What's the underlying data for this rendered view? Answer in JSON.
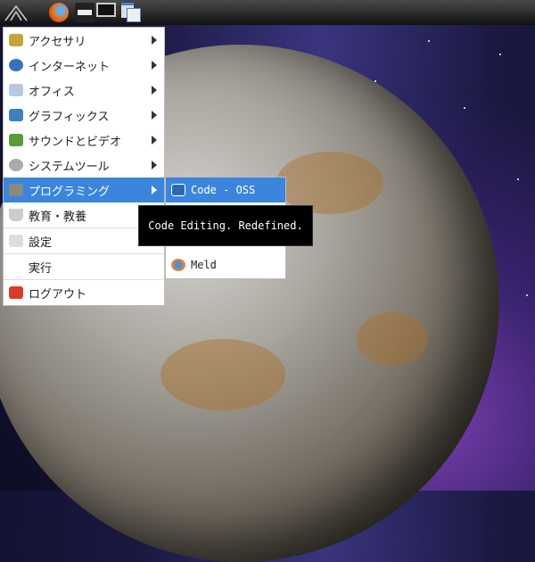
{
  "panel": {
    "icons": [
      "launcher-icon",
      "firefox-icon",
      "file-manager-icon",
      "display-icon",
      "window-switcher-icon"
    ]
  },
  "menu": {
    "items": [
      {
        "label": "アクセサリ",
        "icon": "accessories-icon",
        "submenu": true
      },
      {
        "label": "インターネット",
        "icon": "internet-icon",
        "submenu": true
      },
      {
        "label": "オフィス",
        "icon": "office-icon",
        "submenu": true
      },
      {
        "label": "グラフィックス",
        "icon": "graphics-icon",
        "submenu": true
      },
      {
        "label": "サウンドとビデオ",
        "icon": "sound-video-icon",
        "submenu": true
      },
      {
        "label": "システムツール",
        "icon": "system-tools-icon",
        "submenu": true
      },
      {
        "label": "プログラミング",
        "icon": "programming-icon",
        "submenu": true
      },
      {
        "label": "教育・教養",
        "icon": "education-icon",
        "submenu": true
      },
      {
        "label": "設定",
        "icon": "settings-icon",
        "submenu": false
      },
      {
        "label": "実行",
        "icon": "",
        "submenu": false
      },
      {
        "label": "ログアウト",
        "icon": "logout-icon",
        "submenu": false
      }
    ]
  },
  "submenu": {
    "items": [
      {
        "label": "Code - OSS",
        "icon": "code-oss-icon"
      },
      {
        "label": "Meld",
        "icon": "meld-icon"
      }
    ]
  },
  "tooltip": {
    "text": "Code Editing. Redefined."
  }
}
